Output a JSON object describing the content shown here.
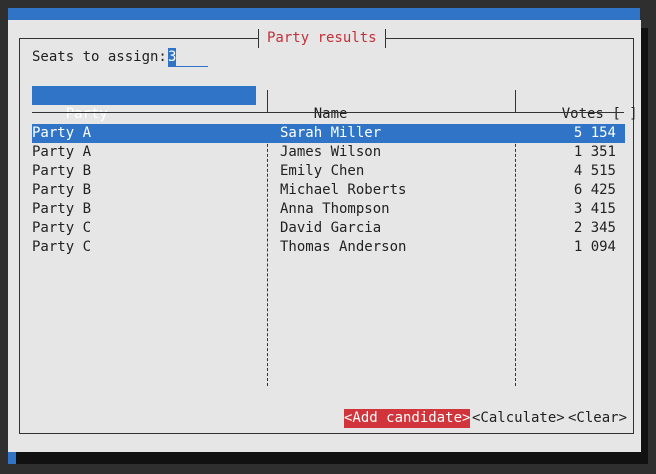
{
  "dialog": {
    "title": "Party results"
  },
  "seats": {
    "label": "Seats to assign:",
    "value": "3"
  },
  "table": {
    "columns": [
      {
        "label": "Party",
        "sort": "[^]"
      },
      {
        "label": "Name",
        "sort": "[ ]"
      },
      {
        "label": "Votes",
        "sort": "[ ]"
      }
    ],
    "rows": [
      {
        "party": "Party A",
        "name": "Sarah Miller",
        "votes": "5 154"
      },
      {
        "party": "Party A",
        "name": "James Wilson",
        "votes": "1 351"
      },
      {
        "party": "Party B",
        "name": "Emily Chen",
        "votes": "4 515"
      },
      {
        "party": "Party B",
        "name": "Michael Roberts",
        "votes": "6 425"
      },
      {
        "party": "Party B",
        "name": "Anna Thompson",
        "votes": "3 415"
      },
      {
        "party": "Party C",
        "name": "David Garcia",
        "votes": "2 345"
      },
      {
        "party": "Party C",
        "name": "Thomas Anderson",
        "votes": "1 094"
      }
    ]
  },
  "buttons": {
    "add": "<Add candidate>",
    "calculate": "<Calculate>",
    "clear": "<Clear>"
  },
  "colors": {
    "accent": "#2f74c7",
    "focus_button": "#d1343a",
    "title_text": "#c0303a",
    "dialog_bg": "#e6e6e6"
  }
}
